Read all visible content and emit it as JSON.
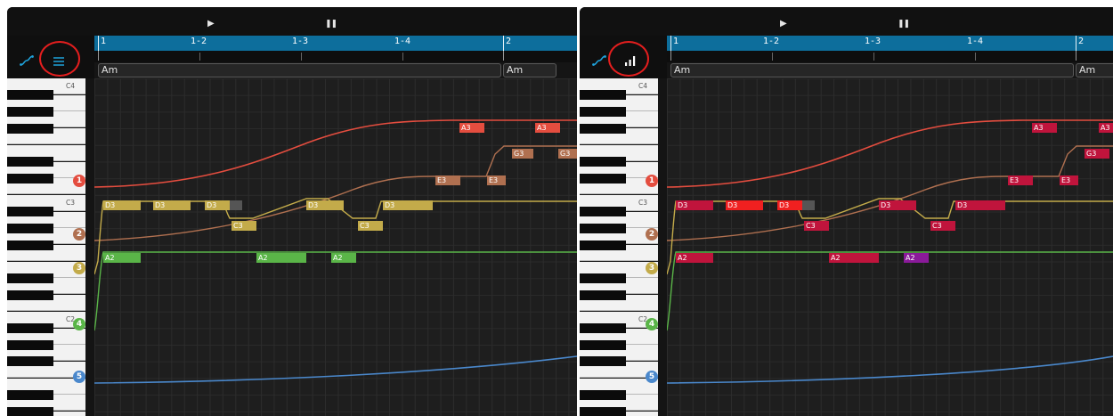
{
  "transport": {
    "play_icon": "▶",
    "pause_icon": "⏸"
  },
  "ruler": {
    "labels": [
      "1",
      "1-2",
      "1-3",
      "1-4",
      "2"
    ]
  },
  "chord_track": {
    "chords": [
      "Am",
      "Am"
    ]
  },
  "keyboard": {
    "labels": [
      "C4",
      "C3",
      "C2"
    ]
  },
  "voices": [
    "1",
    "2",
    "3",
    "4",
    "5"
  ],
  "colors": {
    "ruler_blue": "#0d6e9c",
    "voice1": "#e44d3f",
    "voice2": "#b07050",
    "voice3": "#c3ab4a",
    "voice4": "#5ab548",
    "voice5": "#4a88cc",
    "highlight_circle": "#e41e1e",
    "velocity_red": "#c0143c",
    "bright_red": "#f02020",
    "purple": "#8a1a9a"
  },
  "panel_a": {
    "mode": "voice-color-mode",
    "tool_icons": [
      "curve-icon",
      "list-lines-icon"
    ],
    "notes": {
      "v1": [
        "A3",
        "A3",
        "G3"
      ],
      "v2": [
        "E3",
        "E3",
        "G3"
      ],
      "v3": [
        "D3",
        "D3",
        "D3",
        "C3",
        "D3",
        "C3",
        "D3"
      ],
      "v4": [
        "A2",
        "A2",
        "A2"
      ]
    }
  },
  "panel_b": {
    "mode": "velocity-color-mode",
    "tool_icons": [
      "curve-icon",
      "bar-chart-icon"
    ],
    "notes": {
      "v1": [
        "A3",
        "A3"
      ],
      "v2": [
        "E3",
        "E3",
        "G3"
      ],
      "v3": [
        "D3",
        "D3",
        "D3",
        "C3",
        "D3",
        "C3",
        "D3"
      ],
      "v4": [
        "A2",
        "A2",
        "A2"
      ]
    }
  }
}
